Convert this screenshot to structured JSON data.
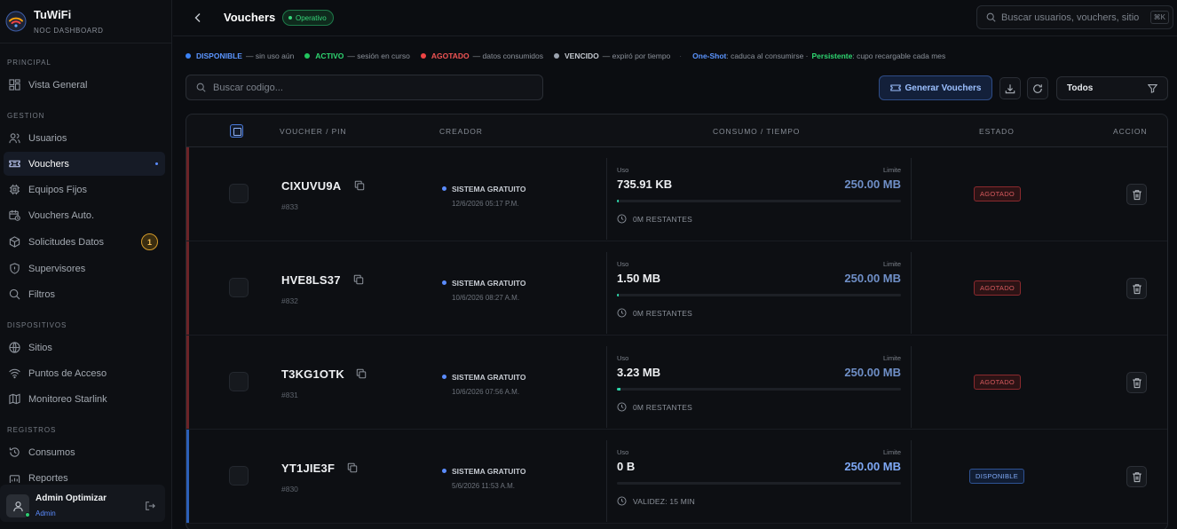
{
  "app": {
    "name": "TuWiFi",
    "subtitle": "NOC DASHBOARD"
  },
  "sidebar": {
    "sections": [
      {
        "label": "PRINCIPAL"
      },
      {
        "label": "GESTION"
      },
      {
        "label": "DISPOSITIVOS"
      },
      {
        "label": "REGISTROS"
      }
    ],
    "items": [
      {
        "label": "Vista General",
        "icon": "dashboard-icon"
      },
      {
        "label": "Usuarios",
        "icon": "users-icon"
      },
      {
        "label": "Vouchers",
        "icon": "ticket-icon",
        "active": true
      },
      {
        "label": "Equipos Fijos",
        "icon": "cpu-icon"
      },
      {
        "label": "Vouchers Auto.",
        "icon": "calendar-clock-icon"
      },
      {
        "label": "Solicitudes Datos",
        "icon": "box-icon",
        "badge": "1"
      },
      {
        "label": "Supervisores",
        "icon": "shield-icon"
      },
      {
        "label": "Filtros",
        "icon": "search-icon"
      },
      {
        "label": "Sitios",
        "icon": "globe-icon"
      },
      {
        "label": "Puntos de Acceso",
        "icon": "wifi-icon"
      },
      {
        "label": "Monitoreo Starlink",
        "icon": "map-icon"
      },
      {
        "label": "Consumos",
        "icon": "history-icon"
      },
      {
        "label": "Reportes",
        "icon": "report-icon"
      }
    ],
    "user": {
      "name": "Admin Optimizar",
      "role": "Admin"
    }
  },
  "header": {
    "title": "Vouchers",
    "status": "Operativo",
    "search_placeholder": "Buscar usuarios, vouchers, sitio",
    "shortcut": "⌘K"
  },
  "legend": {
    "items": [
      {
        "key": "DISPONIBLE",
        "desc": "— sin uso aún",
        "color": "#3b82f6"
      },
      {
        "key": "ACTIVO",
        "desc": "— sesión en curso",
        "color": "#22c55e"
      },
      {
        "key": "AGOTADO",
        "desc": "— datos consumidos",
        "color": "#ef4444"
      },
      {
        "key": "VENCIDO",
        "desc": "— expiró por tiempo",
        "color": "#9ca3af"
      }
    ],
    "separator": "·",
    "oneshot_key": "One-Shot",
    "oneshot_desc": ": caduca al consumirse ·",
    "persist_key": "Persistente",
    "persist_desc": ": cupo recargable cada mes"
  },
  "toolbar": {
    "search_placeholder": "Buscar codigo...",
    "generate_label": "Generar Vouchers",
    "filter_value": "Todos"
  },
  "table": {
    "headers": [
      "VOUCHER / PIN",
      "CREADOR",
      "CONSUMO / TIEMPO",
      "ESTADO",
      "ACCION"
    ],
    "usage_label": "Uso",
    "limit_label": "Limite",
    "rows": [
      {
        "code": "CIXUVU9A",
        "id": "#833",
        "creator": "SISTEMA GRATUITO",
        "date": "12/6/2026 05:17 P.M.",
        "usage": "735.91 KB",
        "limit": "250.00 MB",
        "usage_fraction": 0.003,
        "remaining": "0M RESTANTES",
        "state": "AGOTADO",
        "state_kind": "agotado",
        "accent": "#6b2327",
        "limit_color": "#6f8fc7"
      },
      {
        "code": "HVE8LS37",
        "id": "#832",
        "creator": "SISTEMA GRATUITO",
        "date": "10/6/2026 08:27 A.M.",
        "usage": "1.50 MB",
        "limit": "250.00 MB",
        "usage_fraction": 0.006,
        "remaining": "0M RESTANTES",
        "state": "AGOTADO",
        "state_kind": "agotado",
        "accent": "#6b2327",
        "limit_color": "#6f8fc7"
      },
      {
        "code": "T3KG1OTK",
        "id": "#831",
        "creator": "SISTEMA GRATUITO",
        "date": "10/6/2026 07:56 A.M.",
        "usage": "3.23 MB",
        "limit": "250.00 MB",
        "usage_fraction": 0.013,
        "remaining": "0M RESTANTES",
        "state": "AGOTADO",
        "state_kind": "agotado",
        "accent": "#6b2327",
        "limit_color": "#6f8fc7"
      },
      {
        "code": "YT1JIE3F",
        "id": "#830",
        "creator": "SISTEMA GRATUITO",
        "date": "5/6/2026 11:53 A.M.",
        "usage": "0 B",
        "limit": "250.00 MB",
        "usage_fraction": 0,
        "remaining": "VALIDEZ: 15 MIN",
        "state": "DISPONIBLE",
        "state_kind": "disponible",
        "accent": "#2c5fb8",
        "limit_color": "#7ea8f5"
      }
    ]
  }
}
